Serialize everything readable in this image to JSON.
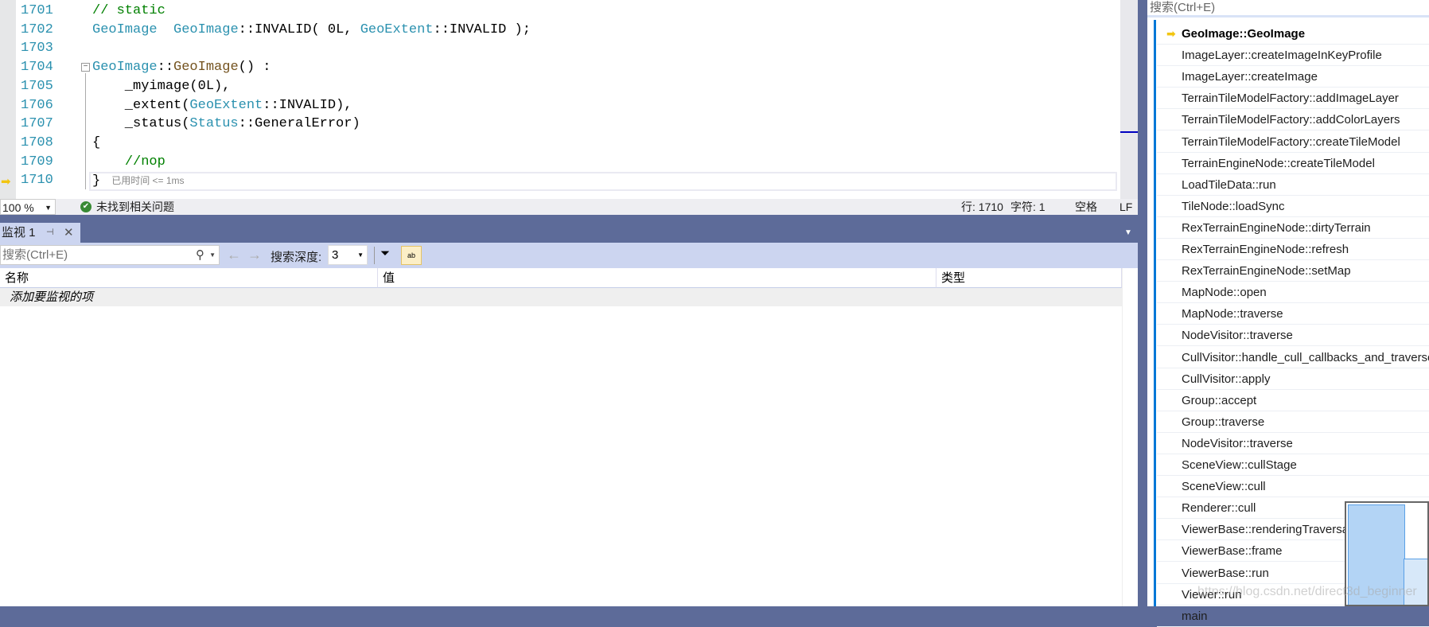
{
  "editor": {
    "lines": [
      {
        "n": "1701",
        "parts": [
          [
            "cm",
            "// static"
          ]
        ]
      },
      {
        "n": "1702",
        "parts": [
          [
            "ty",
            "GeoImage"
          ],
          [
            "",
            "  "
          ],
          [
            "ty",
            "GeoImage"
          ],
          [
            "",
            "::INVALID( 0L, "
          ],
          [
            "ty",
            "GeoExtent"
          ],
          [
            "",
            "::INVALID );"
          ]
        ]
      },
      {
        "n": "1703",
        "parts": []
      },
      {
        "n": "1704",
        "parts": [
          [
            "ty",
            "GeoImage"
          ],
          [
            "",
            "::"
          ],
          [
            "fn",
            "GeoImage"
          ],
          [
            "",
            "() :"
          ]
        ]
      },
      {
        "n": "1705",
        "parts": [
          [
            "",
            "    _myimage(0L),"
          ]
        ]
      },
      {
        "n": "1706",
        "parts": [
          [
            "",
            "    _extent("
          ],
          [
            "ty",
            "GeoExtent"
          ],
          [
            "",
            "::INVALID),"
          ]
        ]
      },
      {
        "n": "1707",
        "parts": [
          [
            "",
            "    _status("
          ],
          [
            "ty",
            "Status"
          ],
          [
            "",
            "::GeneralError)"
          ]
        ]
      },
      {
        "n": "1708",
        "parts": [
          [
            "",
            "{"
          ]
        ]
      },
      {
        "n": "1709",
        "parts": [
          [
            "",
            "    "
          ],
          [
            "cm",
            "//nop"
          ]
        ]
      },
      {
        "n": "1710",
        "parts": [
          [
            "",
            "}"
          ]
        ],
        "hint": "已用时间 <= 1ms"
      }
    ]
  },
  "status": {
    "zoom": "100 %",
    "issues": "未找到相关问题",
    "line": "行: 1710",
    "char": "字符: 1",
    "spaces": "空格",
    "eol": "LF"
  },
  "watch": {
    "tab": "监视 1",
    "search_placeholder": "搜索(Ctrl+E)",
    "depth_label": "搜索深度:",
    "depth": "3",
    "columns": [
      "名称",
      "值",
      "类型"
    ],
    "add_row": "添加要监视的项"
  },
  "callstack": {
    "search_placeholder": "搜索(Ctrl+E)",
    "frames": [
      "GeoImage::GeoImage",
      "ImageLayer::createImageInKeyProfile",
      "ImageLayer::createImage",
      "TerrainTileModelFactory::addImageLayer",
      "TerrainTileModelFactory::addColorLayers",
      "TerrainTileModelFactory::createTileModel",
      "TerrainEngineNode::createTileModel",
      "LoadTileData::run",
      "TileNode::loadSync",
      "RexTerrainEngineNode::dirtyTerrain",
      "RexTerrainEngineNode::refresh",
      "RexTerrainEngineNode::setMap",
      "MapNode::open",
      "MapNode::traverse",
      "NodeVisitor::traverse",
      "CullVisitor::handle_cull_callbacks_and_traverse",
      "CullVisitor::apply",
      "Group::accept",
      "Group::traverse",
      "NodeVisitor::traverse",
      "SceneView::cullStage",
      "SceneView::cull",
      "Renderer::cull",
      "ViewerBase::renderingTraversals",
      "ViewerBase::frame",
      "ViewerBase::run",
      "Viewer::run",
      "main"
    ]
  },
  "watermark": "https://blog.csdn.net/direct3d_beginner",
  "colors": {
    "accent": "#0078d7",
    "band": "#5d6b99",
    "toolbar": "#ccd5f0"
  }
}
